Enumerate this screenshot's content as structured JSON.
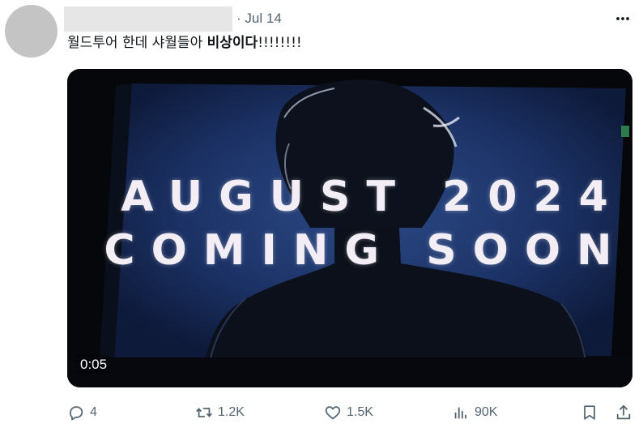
{
  "post": {
    "separator": "·",
    "date": "Jul 14",
    "text_plain": "월드투어 한데 샤월들아 ",
    "text_bold": "비상이다",
    "text_tail": "!!!!!!!!"
  },
  "video": {
    "line1": "AUGUST 2024",
    "line2": "COMING SOON",
    "duration": "0:05"
  },
  "actions": {
    "replies": "4",
    "reposts": "1.2K",
    "likes": "1.5K",
    "views": "90K"
  },
  "icons": {
    "more": "more-icon",
    "reply": "reply-icon",
    "repost": "repost-icon",
    "like": "heart-icon",
    "views": "views-icon",
    "bookmark": "bookmark-icon",
    "share": "share-icon"
  },
  "colors": {
    "muted": "#536471",
    "avatar": "#c4c4c4",
    "redacted": "#e6e6e6"
  }
}
